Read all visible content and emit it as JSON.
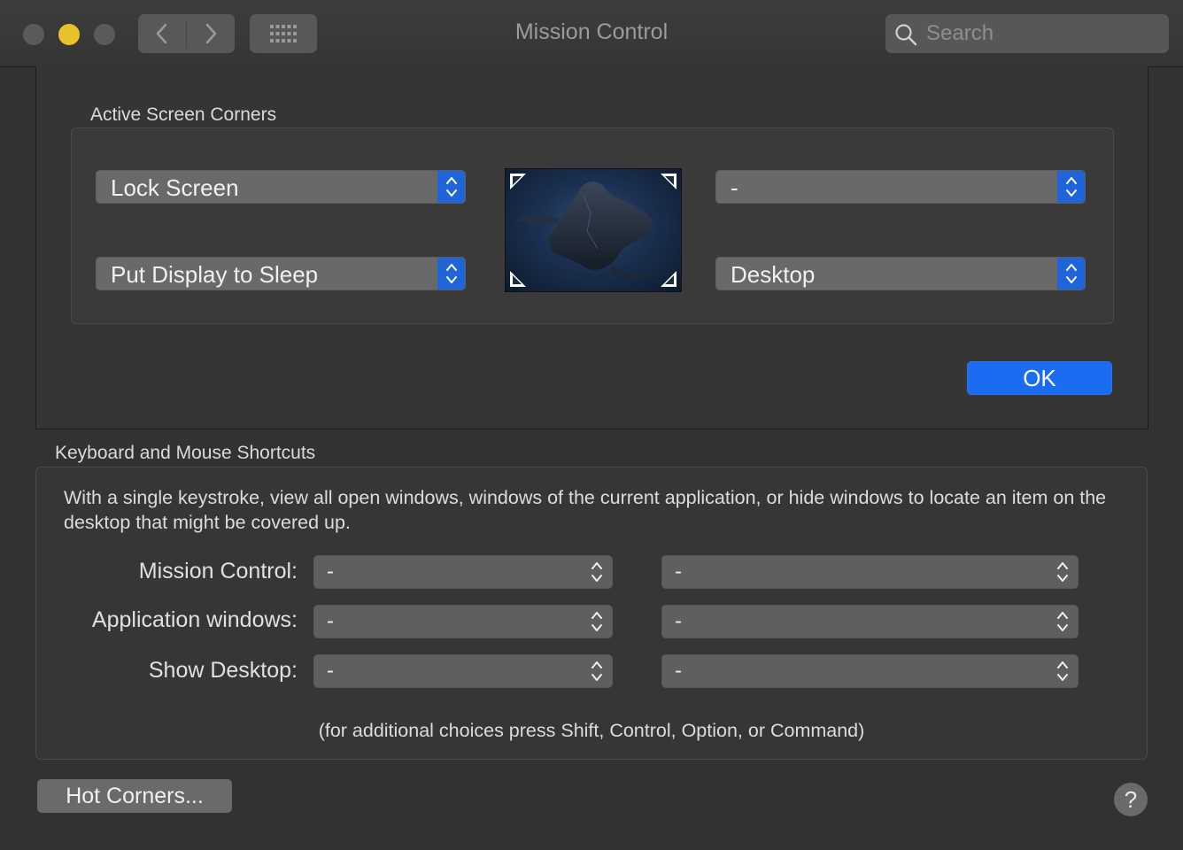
{
  "window": {
    "title": "Mission Control",
    "search_placeholder": "Search"
  },
  "hot_corners_sheet": {
    "group_label": "Active Screen Corners",
    "top_left": "Lock Screen",
    "top_right": "-",
    "bottom_left": "Put Display to Sleep",
    "bottom_right": "Desktop",
    "ok_label": "OK"
  },
  "shortcuts": {
    "group_label": "Keyboard and Mouse Shortcuts",
    "description": "With a single keystroke, view all open windows, windows of the current application, or hide windows to locate an item on the desktop that might be covered up.",
    "rows": [
      {
        "label": "Mission Control:",
        "keyboard": "-",
        "mouse": "-"
      },
      {
        "label": "Application windows:",
        "keyboard": "-",
        "mouse": "-"
      },
      {
        "label": "Show Desktop:",
        "keyboard": "-",
        "mouse": "-"
      }
    ],
    "hint": "(for additional choices press Shift, Control, Option, or Command)"
  },
  "footer": {
    "hot_corners_label": "Hot Corners...",
    "help_label": "?"
  },
  "colors": {
    "accent": "#1c6cf2",
    "minimize": "#e9c12b"
  }
}
